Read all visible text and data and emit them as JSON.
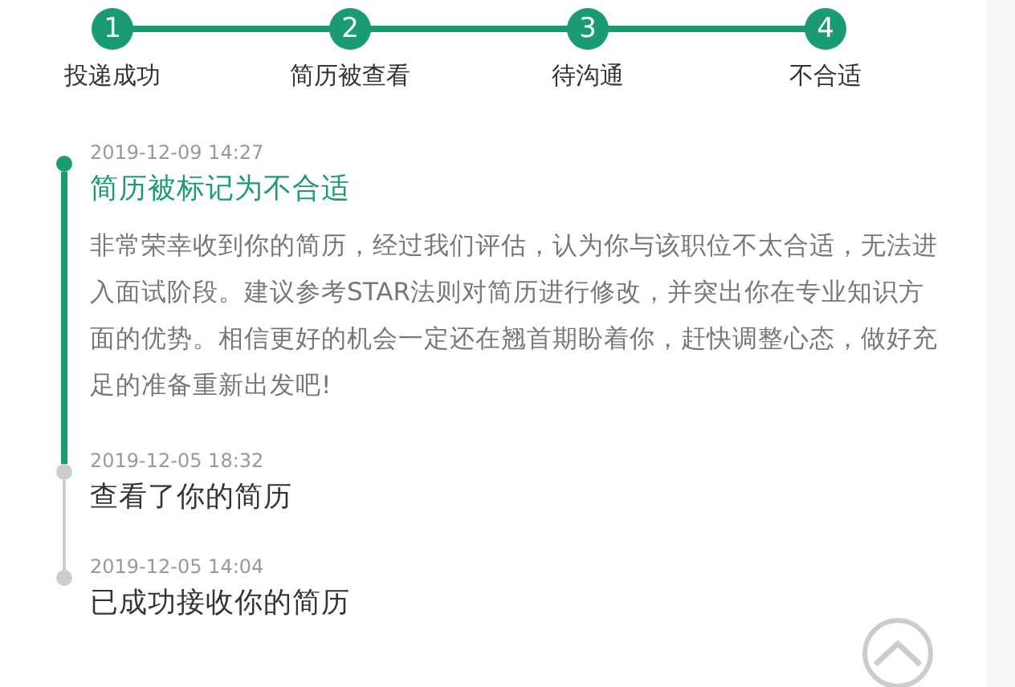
{
  "steps": [
    {
      "number": "1",
      "label": "投递成功",
      "completed": true
    },
    {
      "number": "2",
      "label": "简历被查看",
      "completed": true
    },
    {
      "number": "3",
      "label": "待沟通",
      "completed": true
    },
    {
      "number": "4",
      "label": "不合适",
      "completed": true
    }
  ],
  "timeline": [
    {
      "time": "2019-12-09 14:27",
      "title": "简历被标记为不合适",
      "active": true,
      "body": "非常荣幸收到你的简历，经过我们评估，认为你与该职位不太合适，无法进入面试阶段。建议参考STAR法则对简历进行修改，并突出你在专业知识方面的优势。相信更好的机会一定还在翘首期盼着你，赶快调整心态，做好充足的准备重新出发吧!"
    },
    {
      "time": "2019-12-05 18:32",
      "title": "查看了你的简历",
      "active": false
    },
    {
      "time": "2019-12-05 14:04",
      "title": "已成功接收你的简历",
      "active": false
    }
  ]
}
